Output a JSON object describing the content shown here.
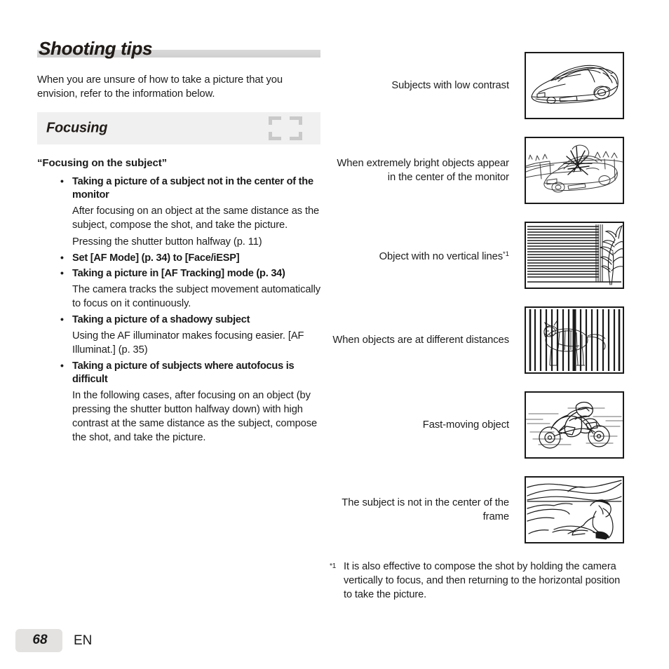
{
  "document": {
    "chapter_title": "Shooting tips",
    "intro": "When you are unsure of how to take a picture that you envision, refer to the information below."
  },
  "section": {
    "title": "Focusing",
    "icon": "af-target-icon"
  },
  "left_column": {
    "quote_heading": "“Focusing on the subject”",
    "blocks": [
      {
        "type": "bullet",
        "text": "Taking a picture of a subject not in the center of the monitor"
      },
      {
        "type": "para",
        "text": "After focusing on an object at the same distance as the subject, compose the shot, and take the picture."
      },
      {
        "type": "para",
        "text": "Pressing the shutter button halfway (p. 11)"
      },
      {
        "type": "bullet",
        "text": "Set [AF Mode] (p. 34) to [Face/iESP]"
      },
      {
        "type": "bullet",
        "text": "Taking a picture in [AF Tracking] mode (p. 34)"
      },
      {
        "type": "para",
        "text": "The camera tracks the subject movement automatically to focus on it continuously."
      },
      {
        "type": "bullet",
        "text": "Taking a picture of a shadowy subject"
      },
      {
        "type": "para",
        "text": "Using the AF illuminator makes focusing easier. [AF Illuminat.] (p. 35)"
      },
      {
        "type": "bullet",
        "text": "Taking a picture of subjects where autofocus is difficult"
      },
      {
        "type": "para",
        "text": "In the following cases, after focusing on an object (by pressing the shutter button halfway down) with high contrast at the same distance as the subject, compose the shot, and take the picture."
      }
    ]
  },
  "right_column": {
    "examples": [
      {
        "caption": "Subjects with low contrast",
        "footnote_marker": "",
        "figure": "sports-car-illustration"
      },
      {
        "caption": "When extremely bright objects appear in the center of the monitor",
        "footnote_marker": "",
        "figure": "bright-glare-car-illustration"
      },
      {
        "caption": "Object with no vertical lines",
        "footnote_marker": "*1",
        "figure": "horizontal-blinds-illustration"
      },
      {
        "caption": "When objects are at different distances",
        "footnote_marker": "",
        "figure": "tiger-behind-bars-illustration"
      },
      {
        "caption": "Fast-moving object",
        "footnote_marker": "",
        "figure": "motorcycle-illustration"
      },
      {
        "caption": "The subject is not in the center of the frame",
        "footnote_marker": "",
        "figure": "beach-person-illustration"
      }
    ],
    "footnote": {
      "marker": "*1",
      "text": "It is also effective to compose the shot by holding the camera vertically to focus, and then returning to the horizontal position to take the picture."
    }
  },
  "footer": {
    "page_number": "68",
    "language": "EN"
  },
  "colors": {
    "band_gray": "#f0f0f0",
    "title_bar_gray": "#d6d6d6",
    "chip_gray": "#e3e2e0",
    "ink": "#1a1a1a"
  }
}
